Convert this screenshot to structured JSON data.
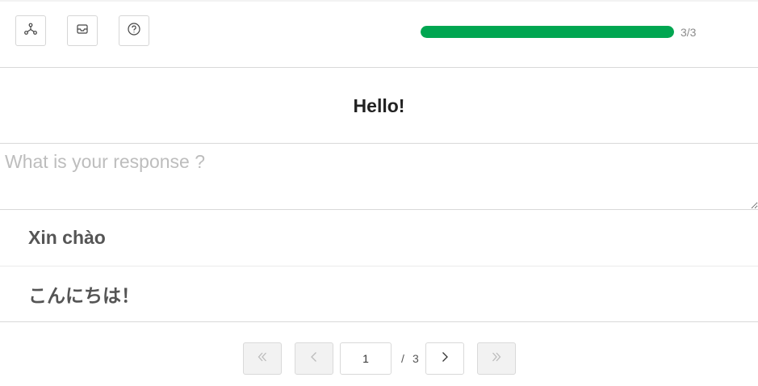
{
  "toolbar": {
    "buttons": [
      {
        "icon": "network-icon"
      },
      {
        "icon": "inbox-icon"
      },
      {
        "icon": "help-icon"
      }
    ],
    "progress": {
      "fraction": 1.0,
      "label": "3/3",
      "color": "#00a651"
    }
  },
  "question": {
    "text": "Hello!"
  },
  "response": {
    "value": "",
    "placeholder": "What is your response ?"
  },
  "answers": [
    {
      "text": "Xin chào"
    },
    {
      "text": "こんにちは！"
    }
  ],
  "pagination": {
    "current": "1",
    "separator": "/",
    "total": "3"
  }
}
